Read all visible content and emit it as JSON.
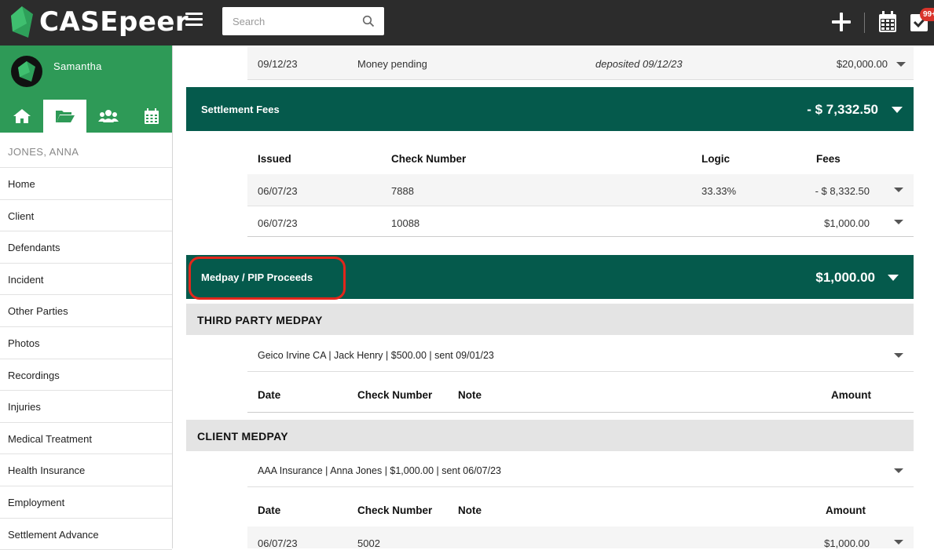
{
  "app": {
    "name": "CASEpeer"
  },
  "search": {
    "placeholder": "Search"
  },
  "topbar": {
    "task_badge": "99+"
  },
  "user": {
    "name": "Samantha"
  },
  "case": {
    "name": "JONES, ANNA"
  },
  "sidebar": {
    "items": [
      {
        "label": "Home"
      },
      {
        "label": "Client"
      },
      {
        "label": "Defendants"
      },
      {
        "label": "Incident"
      },
      {
        "label": "Other Parties"
      },
      {
        "label": "Photos"
      },
      {
        "label": "Recordings"
      },
      {
        "label": "Injuries"
      },
      {
        "label": "Medical Treatment"
      },
      {
        "label": "Health Insurance"
      },
      {
        "label": "Employment"
      },
      {
        "label": "Settlement Advance"
      }
    ]
  },
  "deposit_row": {
    "date": "09/12/23",
    "description": "Money pending",
    "note": "deposited 09/12/23",
    "amount": "$20,000.00"
  },
  "settlement_fees": {
    "title": "Settlement Fees",
    "total": "- $ 7,332.50",
    "headers": {
      "issued": "Issued",
      "check": "Check Number",
      "logic": "Logic",
      "fees": "Fees"
    },
    "rows": [
      {
        "issued": "06/07/23",
        "check": "7888",
        "logic": "33.33%",
        "fees": "- $ 8,332.50"
      },
      {
        "issued": "06/07/23",
        "check": "10088",
        "logic": "",
        "fees": "$1,000.00"
      }
    ]
  },
  "medpay": {
    "title": "Medpay / PIP Proceeds",
    "total": "$1,000.00",
    "third_party": {
      "heading": "THIRD PARTY MEDPAY",
      "entry": "Geico Irvine CA | Jack Henry | $500.00 | sent 09/01/23",
      "headers": {
        "date": "Date",
        "check": "Check Number",
        "note": "Note",
        "amount": "Amount"
      }
    },
    "client": {
      "heading": "CLIENT MEDPAY",
      "entry": "AAA Insurance | Anna Jones | $1,000.00 | sent 06/07/23",
      "headers": {
        "date": "Date",
        "check": "Check Number",
        "note": "Note",
        "amount": "Amount"
      },
      "rows": [
        {
          "date": "06/07/23",
          "check": "5002",
          "note": "",
          "amount": "$1,000.00"
        }
      ]
    }
  }
}
